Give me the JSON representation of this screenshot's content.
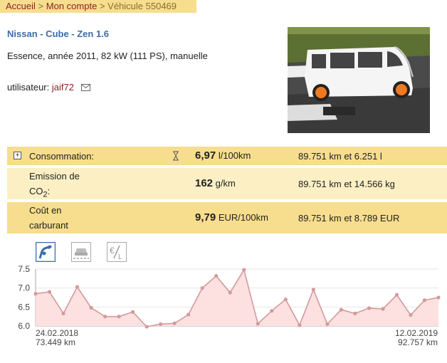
{
  "breadcrumb": {
    "home": "Accueil",
    "sep1": ">",
    "account": "Mon compte",
    "sep2": ">",
    "current": "Véhicule 550469"
  },
  "vehicle": {
    "title": "Nissan - Cube - Zen 1.6",
    "specs": "Essence, année 2011, 82 kW (111 PS), manuelle",
    "user_label": "utilisateur:",
    "user_name": "jaif72"
  },
  "stats": {
    "consumption": {
      "label": "Consommation:",
      "value": "6,97",
      "unit": "l/100km",
      "extra": "89.751 km et 6.251 l"
    },
    "emission": {
      "label_line1": "Emission de",
      "label_line2_prefix": "CO",
      "label_line2_sub": "2",
      "label_line2_suffix": ":",
      "value": "162",
      "unit": "g/km",
      "extra": "89.751 km et 14.566 kg"
    },
    "cost": {
      "label_line1": "Coût en",
      "label_line2": "carburant",
      "value": "9,79",
      "unit": "EUR/100km",
      "extra": "89.751 km et 8.789 EUR"
    }
  },
  "tools": [
    {
      "icon": "fuel-pump-icon",
      "active": true
    },
    {
      "icon": "car-road-icon",
      "active": false
    },
    {
      "icon": "euro-per-liter-icon",
      "active": false
    }
  ],
  "colors": {
    "header_bg": "#f7dd8e",
    "row_alt": "#fcefc4",
    "link": "#8a2222",
    "title": "#3b6ba8",
    "line": "#d39a9a",
    "fill": "#fde0e0"
  },
  "chart_data": {
    "type": "area",
    "title": "",
    "xlabel": "",
    "ylabel": "",
    "ylim": [
      6.0,
      7.5
    ],
    "yticks": [
      "7.5",
      "7.0",
      "6.5",
      "6.0"
    ],
    "grid": true,
    "series": [
      {
        "values": [
          6.85,
          6.9,
          6.33,
          7.03,
          6.48,
          6.25,
          6.25,
          6.37,
          5.98,
          6.05,
          6.07,
          6.3,
          7.0,
          7.32,
          6.88,
          7.48,
          6.06,
          6.4,
          6.7,
          6.02,
          6.96,
          6.05,
          6.43,
          6.33,
          6.47,
          6.45,
          6.82,
          6.29,
          6.68,
          6.75
        ]
      }
    ],
    "x_start": {
      "date": "24.02.2018",
      "km": "73.449 km"
    },
    "x_end": {
      "date": "12.02.2019",
      "km": "92.757 km"
    }
  }
}
